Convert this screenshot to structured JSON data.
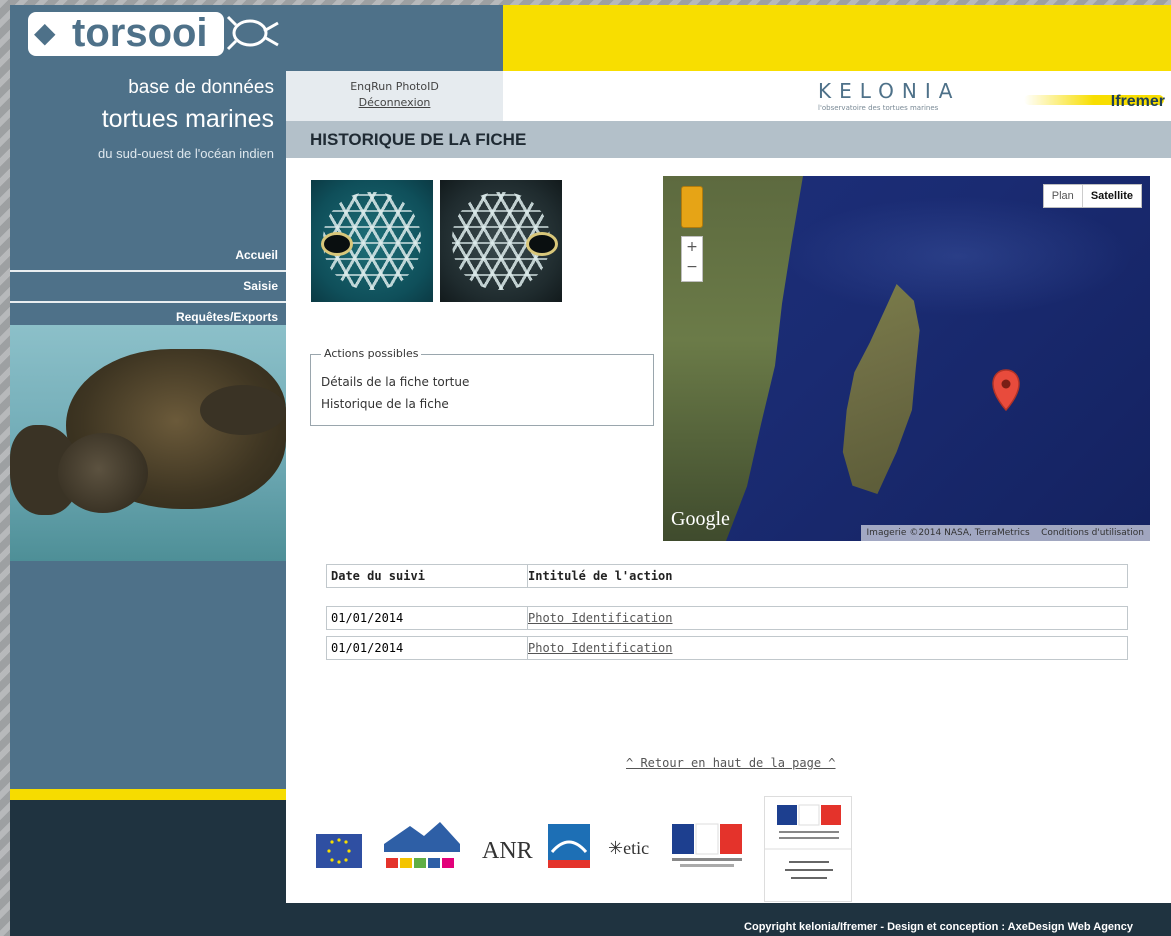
{
  "brand": {
    "logo_text": "torsooi",
    "tagline1": "base de données",
    "tagline2": "tortues marines",
    "tagline3": "du sud-ouest de l'océan indien"
  },
  "nav": {
    "items": [
      {
        "label": "Accueil"
      },
      {
        "label": "Saisie"
      },
      {
        "label": "Requêtes/Exports"
      }
    ]
  },
  "user": {
    "name": "EnqRun PhotoID",
    "logout": "Déconnexion"
  },
  "kelonia": {
    "name": "KELONIA",
    "sub": "l'observatoire des tortues marines"
  },
  "ifremer": {
    "name": "Ifremer"
  },
  "page": {
    "title": "HISTORIQUE DE LA FICHE"
  },
  "actions": {
    "legend": "Actions possibles",
    "items": [
      {
        "label": "Détails de la fiche tortue"
      },
      {
        "label": "Historique de la fiche"
      }
    ]
  },
  "map": {
    "view_plan": "Plan",
    "view_satellite": "Satellite",
    "google": "Google",
    "attribution": "Imagerie ©2014 NASA, TerraMetrics",
    "terms": "Conditions d'utilisation",
    "zoom_in": "+",
    "zoom_out": "−"
  },
  "history_table": {
    "headers": [
      "Date du suivi",
      "Intitulé de l'action"
    ],
    "rows": [
      {
        "date": "01/01/2014",
        "action": "Photo Identification"
      },
      {
        "date": "01/01/2014",
        "action": "Photo Identification"
      }
    ]
  },
  "back_to_top": "^ Retour en haut de la page ^",
  "partners": {
    "anr": "ANR",
    "etic": "etic"
  },
  "footer": {
    "copyright": "Copyright kelonia/Ifremer - Design et conception : AxeDesign Web Agency"
  },
  "colors": {
    "sidebar_blue": "#4e7189",
    "accent_yellow": "#f8de00",
    "title_bar": "#b3c0c9",
    "footer_dark": "#1f3340"
  }
}
